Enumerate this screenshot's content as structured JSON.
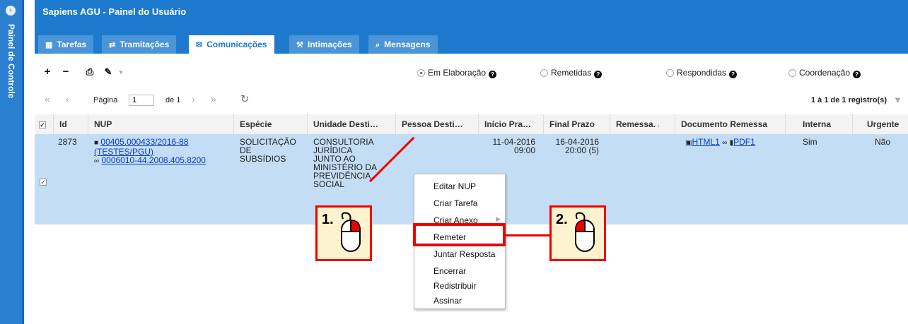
{
  "sidebar": {
    "title": "Painel de Controle",
    "toggle_icon": "chevron-right-circle-icon"
  },
  "header": {
    "title": "Sapiens AGU - Painel do Usuário"
  },
  "tabs": [
    {
      "label": "Tarefas",
      "icon": "calendar-icon"
    },
    {
      "label": "Tramitações",
      "icon": "exchange-icon"
    },
    {
      "label": "Comunicações",
      "icon": "envelope-icon",
      "active": true
    },
    {
      "label": "Intimações",
      "icon": "gavel-icon"
    },
    {
      "label": "Mensagens",
      "icon": "chat-icon"
    }
  ],
  "filters": [
    {
      "label": "Em Elaboração",
      "selected": true
    },
    {
      "label": "Remetidas",
      "selected": false
    },
    {
      "label": "Respondidas",
      "selected": false
    },
    {
      "label": "Coordenação",
      "selected": false
    }
  ],
  "pager": {
    "page_label": "Página",
    "page_value": "1",
    "of_label": "de 1",
    "count": "1 à 1 de 1 registro(s)"
  },
  "columns": [
    "Id",
    "NUP",
    "Espécie",
    "Unidade Desti…",
    "Pessoa Desti…",
    "Início Pra…",
    "Final Prazo",
    "Remessa.",
    "Documento Remessa",
    "Interna",
    "Urgente"
  ],
  "row": {
    "id": "2873",
    "nup_1": "00405.000433/2016-88",
    "nup_2": "(TESTES/PGU)",
    "nup_3": "0006010-44.2008.405.8200",
    "especie": [
      "SOLICITAÇÃO",
      "DE",
      "SUBSÍDIOS"
    ],
    "unidade": [
      "CONSULTORIA",
      "JURÍDICA",
      "JUNTO AO",
      "MINISTÉRIO DA",
      "PREVIDÊNCIA",
      "SOCIAL"
    ],
    "inicio": [
      "11-04-2016",
      "09:00"
    ],
    "final": [
      "16-04-2016",
      "20:00 (5)"
    ],
    "doc_html": "HTML1",
    "doc_pdf": "PDF1",
    "interna": "Sim",
    "urgente": "Não"
  },
  "context_menu": [
    "Editar NUP",
    "Criar Tarefa",
    "Criar Anexo",
    "Remeter",
    "Juntar Resposta",
    "Encerrar",
    "Redistribuir",
    "Assinar"
  ],
  "annotations": {
    "step1": "1.",
    "step2": "2.",
    "highlight_color": "#e00000"
  },
  "colors": {
    "header": "#1e7acd",
    "sidebar": "#2b7fd0",
    "selected_row": "#c3ddf4"
  }
}
